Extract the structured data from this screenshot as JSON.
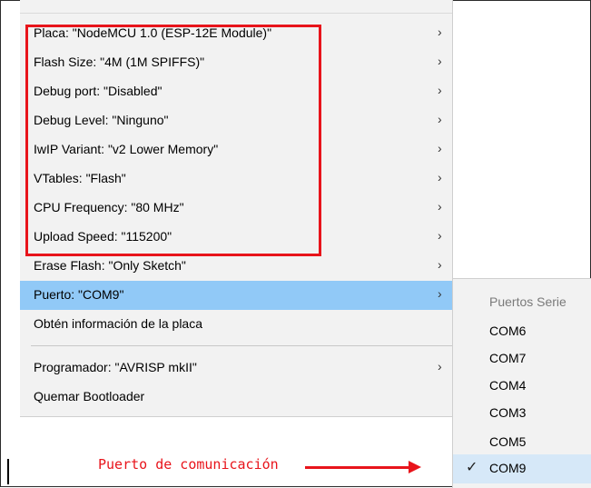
{
  "menu": {
    "items": [
      {
        "label": "Placa: \"NodeMCU 1.0 (ESP-12E Module)\"",
        "arrow": "›"
      },
      {
        "label": "Flash Size: \"4M (1M SPIFFS)\"",
        "arrow": "›"
      },
      {
        "label": "Debug port: \"Disabled\"",
        "arrow": "›"
      },
      {
        "label": "Debug Level: \"Ninguno\"",
        "arrow": "›"
      },
      {
        "label": "IwIP Variant: \"v2 Lower Memory\"",
        "arrow": "›"
      },
      {
        "label": "VTables: \"Flash\"",
        "arrow": "›"
      },
      {
        "label": "CPU Frequency: \"80 MHz\"",
        "arrow": "›"
      },
      {
        "label": "Upload Speed: \"115200\"",
        "arrow": "›"
      },
      {
        "label": "Erase Flash: \"Only Sketch\"",
        "arrow": "›"
      },
      {
        "label": "Puerto: \"COM9\"",
        "arrow": "›"
      },
      {
        "label": "Obtén información de la placa"
      },
      {
        "label": "Programador: \"AVRISP mkII\"",
        "arrow": "›"
      },
      {
        "label": "Quemar Bootloader"
      }
    ]
  },
  "submenu": {
    "header": "Puertos Serie",
    "ports": [
      "COM6",
      "COM7",
      "COM4",
      "COM3",
      "COM5",
      "COM9"
    ],
    "selected": "COM9",
    "check_glyph": "✓"
  },
  "annotation": {
    "text": "Puerto de comunicación"
  },
  "colors": {
    "highlight": "#e8141b",
    "active_item": "#91c9f7",
    "menu_bg": "#f2f2f2"
  }
}
